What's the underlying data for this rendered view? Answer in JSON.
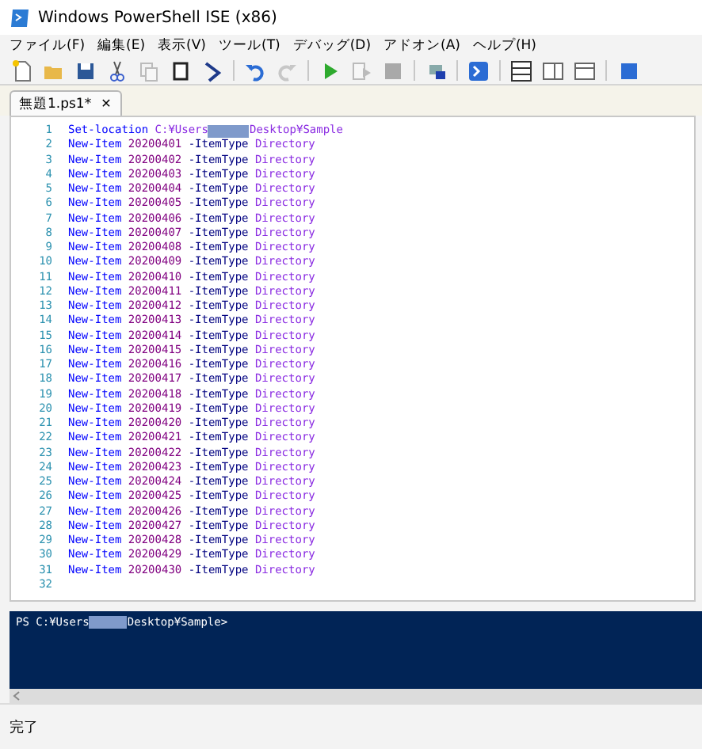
{
  "window": {
    "title": "Windows PowerShell ISE (x86)"
  },
  "menu": [
    "ファイル(F)",
    "編集(E)",
    "表示(V)",
    "ツール(T)",
    "デバッグ(D)",
    "アドオン(A)",
    "ヘルプ(H)"
  ],
  "toolbar": [
    {
      "kind": "new",
      "disabled": false
    },
    {
      "kind": "open",
      "disabled": false
    },
    {
      "kind": "save",
      "disabled": false
    },
    {
      "kind": "cut",
      "disabled": false
    },
    {
      "kind": "copy",
      "disabled": true
    },
    {
      "kind": "paste",
      "disabled": false
    },
    {
      "kind": "clear",
      "disabled": false
    },
    {
      "kind": "sep"
    },
    {
      "kind": "undo",
      "disabled": false
    },
    {
      "kind": "redo",
      "disabled": true
    },
    {
      "kind": "sep"
    },
    {
      "kind": "run",
      "disabled": false
    },
    {
      "kind": "runsel",
      "disabled": true
    },
    {
      "kind": "stop",
      "disabled": true
    },
    {
      "kind": "sep"
    },
    {
      "kind": "remote",
      "disabled": false
    },
    {
      "kind": "sep"
    },
    {
      "kind": "console",
      "disabled": false
    },
    {
      "kind": "sep"
    },
    {
      "kind": "layout-top",
      "disabled": false
    },
    {
      "kind": "layout-right",
      "disabled": false
    },
    {
      "kind": "layout-max",
      "disabled": false
    },
    {
      "kind": "sep"
    },
    {
      "kind": "addon",
      "disabled": false
    }
  ],
  "tabs": [
    {
      "label": "無題1.ps1*",
      "close": "✕",
      "selected": true
    }
  ],
  "editor": {
    "lines": [
      {
        "number": "1",
        "tokens": [
          {
            "kind": "cmdlet",
            "text": "Set-location"
          },
          {
            "kind": "argument",
            "text": "C:¥Users"
          },
          {
            "kind": "redacted"
          },
          {
            "kind": "argument",
            "text": "Desktop¥Sample"
          }
        ]
      },
      {
        "number": "2",
        "tokens": [
          {
            "kind": "cmdlet",
            "text": "New-Item"
          },
          {
            "kind": "number",
            "text": "20200401"
          },
          {
            "kind": "parameter",
            "text": "-ItemType"
          },
          {
            "kind": "argument",
            "text": "Directory"
          }
        ]
      },
      {
        "number": "3",
        "tokens": [
          {
            "kind": "cmdlet",
            "text": "New-Item"
          },
          {
            "kind": "number",
            "text": "20200402"
          },
          {
            "kind": "parameter",
            "text": "-ItemType"
          },
          {
            "kind": "argument",
            "text": "Directory"
          }
        ]
      },
      {
        "number": "4",
        "tokens": [
          {
            "kind": "cmdlet",
            "text": "New-Item"
          },
          {
            "kind": "number",
            "text": "20200403"
          },
          {
            "kind": "parameter",
            "text": "-ItemType"
          },
          {
            "kind": "argument",
            "text": "Directory"
          }
        ]
      },
      {
        "number": "5",
        "tokens": [
          {
            "kind": "cmdlet",
            "text": "New-Item"
          },
          {
            "kind": "number",
            "text": "20200404"
          },
          {
            "kind": "parameter",
            "text": "-ItemType"
          },
          {
            "kind": "argument",
            "text": "Directory"
          }
        ]
      },
      {
        "number": "6",
        "tokens": [
          {
            "kind": "cmdlet",
            "text": "New-Item"
          },
          {
            "kind": "number",
            "text": "20200405"
          },
          {
            "kind": "parameter",
            "text": "-ItemType"
          },
          {
            "kind": "argument",
            "text": "Directory"
          }
        ]
      },
      {
        "number": "7",
        "tokens": [
          {
            "kind": "cmdlet",
            "text": "New-Item"
          },
          {
            "kind": "number",
            "text": "20200406"
          },
          {
            "kind": "parameter",
            "text": "-ItemType"
          },
          {
            "kind": "argument",
            "text": "Directory"
          }
        ]
      },
      {
        "number": "8",
        "tokens": [
          {
            "kind": "cmdlet",
            "text": "New-Item"
          },
          {
            "kind": "number",
            "text": "20200407"
          },
          {
            "kind": "parameter",
            "text": "-ItemType"
          },
          {
            "kind": "argument",
            "text": "Directory"
          }
        ]
      },
      {
        "number": "9",
        "tokens": [
          {
            "kind": "cmdlet",
            "text": "New-Item"
          },
          {
            "kind": "number",
            "text": "20200408"
          },
          {
            "kind": "parameter",
            "text": "-ItemType"
          },
          {
            "kind": "argument",
            "text": "Directory"
          }
        ]
      },
      {
        "number": "10",
        "tokens": [
          {
            "kind": "cmdlet",
            "text": "New-Item"
          },
          {
            "kind": "number",
            "text": "20200409"
          },
          {
            "kind": "parameter",
            "text": "-ItemType"
          },
          {
            "kind": "argument",
            "text": "Directory"
          }
        ]
      },
      {
        "number": "11",
        "tokens": [
          {
            "kind": "cmdlet",
            "text": "New-Item"
          },
          {
            "kind": "number",
            "text": "20200410"
          },
          {
            "kind": "parameter",
            "text": "-ItemType"
          },
          {
            "kind": "argument",
            "text": "Directory"
          }
        ]
      },
      {
        "number": "12",
        "tokens": [
          {
            "kind": "cmdlet",
            "text": "New-Item"
          },
          {
            "kind": "number",
            "text": "20200411"
          },
          {
            "kind": "parameter",
            "text": "-ItemType"
          },
          {
            "kind": "argument",
            "text": "Directory"
          }
        ]
      },
      {
        "number": "13",
        "tokens": [
          {
            "kind": "cmdlet",
            "text": "New-Item"
          },
          {
            "kind": "number",
            "text": "20200412"
          },
          {
            "kind": "parameter",
            "text": "-ItemType"
          },
          {
            "kind": "argument",
            "text": "Directory"
          }
        ]
      },
      {
        "number": "14",
        "tokens": [
          {
            "kind": "cmdlet",
            "text": "New-Item"
          },
          {
            "kind": "number",
            "text": "20200413"
          },
          {
            "kind": "parameter",
            "text": "-ItemType"
          },
          {
            "kind": "argument",
            "text": "Directory"
          }
        ]
      },
      {
        "number": "15",
        "tokens": [
          {
            "kind": "cmdlet",
            "text": "New-Item"
          },
          {
            "kind": "number",
            "text": "20200414"
          },
          {
            "kind": "parameter",
            "text": "-ItemType"
          },
          {
            "kind": "argument",
            "text": "Directory"
          }
        ]
      },
      {
        "number": "16",
        "tokens": [
          {
            "kind": "cmdlet",
            "text": "New-Item"
          },
          {
            "kind": "number",
            "text": "20200415"
          },
          {
            "kind": "parameter",
            "text": "-ItemType"
          },
          {
            "kind": "argument",
            "text": "Directory"
          }
        ]
      },
      {
        "number": "17",
        "tokens": [
          {
            "kind": "cmdlet",
            "text": "New-Item"
          },
          {
            "kind": "number",
            "text": "20200416"
          },
          {
            "kind": "parameter",
            "text": "-ItemType"
          },
          {
            "kind": "argument",
            "text": "Directory"
          }
        ]
      },
      {
        "number": "18",
        "tokens": [
          {
            "kind": "cmdlet",
            "text": "New-Item"
          },
          {
            "kind": "number",
            "text": "20200417"
          },
          {
            "kind": "parameter",
            "text": "-ItemType"
          },
          {
            "kind": "argument",
            "text": "Directory"
          }
        ]
      },
      {
        "number": "19",
        "tokens": [
          {
            "kind": "cmdlet",
            "text": "New-Item"
          },
          {
            "kind": "number",
            "text": "20200418"
          },
          {
            "kind": "parameter",
            "text": "-ItemType"
          },
          {
            "kind": "argument",
            "text": "Directory"
          }
        ]
      },
      {
        "number": "20",
        "tokens": [
          {
            "kind": "cmdlet",
            "text": "New-Item"
          },
          {
            "kind": "number",
            "text": "20200419"
          },
          {
            "kind": "parameter",
            "text": "-ItemType"
          },
          {
            "kind": "argument",
            "text": "Directory"
          }
        ]
      },
      {
        "number": "21",
        "tokens": [
          {
            "kind": "cmdlet",
            "text": "New-Item"
          },
          {
            "kind": "number",
            "text": "20200420"
          },
          {
            "kind": "parameter",
            "text": "-ItemType"
          },
          {
            "kind": "argument",
            "text": "Directory"
          }
        ]
      },
      {
        "number": "22",
        "tokens": [
          {
            "kind": "cmdlet",
            "text": "New-Item"
          },
          {
            "kind": "number",
            "text": "20200421"
          },
          {
            "kind": "parameter",
            "text": "-ItemType"
          },
          {
            "kind": "argument",
            "text": "Directory"
          }
        ]
      },
      {
        "number": "23",
        "tokens": [
          {
            "kind": "cmdlet",
            "text": "New-Item"
          },
          {
            "kind": "number",
            "text": "20200422"
          },
          {
            "kind": "parameter",
            "text": "-ItemType"
          },
          {
            "kind": "argument",
            "text": "Directory"
          }
        ]
      },
      {
        "number": "24",
        "tokens": [
          {
            "kind": "cmdlet",
            "text": "New-Item"
          },
          {
            "kind": "number",
            "text": "20200423"
          },
          {
            "kind": "parameter",
            "text": "-ItemType"
          },
          {
            "kind": "argument",
            "text": "Directory"
          }
        ]
      },
      {
        "number": "25",
        "tokens": [
          {
            "kind": "cmdlet",
            "text": "New-Item"
          },
          {
            "kind": "number",
            "text": "20200424"
          },
          {
            "kind": "parameter",
            "text": "-ItemType"
          },
          {
            "kind": "argument",
            "text": "Directory"
          }
        ]
      },
      {
        "number": "26",
        "tokens": [
          {
            "kind": "cmdlet",
            "text": "New-Item"
          },
          {
            "kind": "number",
            "text": "20200425"
          },
          {
            "kind": "parameter",
            "text": "-ItemType"
          },
          {
            "kind": "argument",
            "text": "Directory"
          }
        ]
      },
      {
        "number": "27",
        "tokens": [
          {
            "kind": "cmdlet",
            "text": "New-Item"
          },
          {
            "kind": "number",
            "text": "20200426"
          },
          {
            "kind": "parameter",
            "text": "-ItemType"
          },
          {
            "kind": "argument",
            "text": "Directory"
          }
        ]
      },
      {
        "number": "28",
        "tokens": [
          {
            "kind": "cmdlet",
            "text": "New-Item"
          },
          {
            "kind": "number",
            "text": "20200427"
          },
          {
            "kind": "parameter",
            "text": "-ItemType"
          },
          {
            "kind": "argument",
            "text": "Directory"
          }
        ]
      },
      {
        "number": "29",
        "tokens": [
          {
            "kind": "cmdlet",
            "text": "New-Item"
          },
          {
            "kind": "number",
            "text": "20200428"
          },
          {
            "kind": "parameter",
            "text": "-ItemType"
          },
          {
            "kind": "argument",
            "text": "Directory"
          }
        ]
      },
      {
        "number": "30",
        "tokens": [
          {
            "kind": "cmdlet",
            "text": "New-Item"
          },
          {
            "kind": "number",
            "text": "20200429"
          },
          {
            "kind": "parameter",
            "text": "-ItemType"
          },
          {
            "kind": "argument",
            "text": "Directory"
          }
        ]
      },
      {
        "number": "31",
        "tokens": [
          {
            "kind": "cmdlet",
            "text": "New-Item"
          },
          {
            "kind": "number",
            "text": "20200430"
          },
          {
            "kind": "parameter",
            "text": "-ItemType"
          },
          {
            "kind": "argument",
            "text": "Directory"
          }
        ]
      },
      {
        "number": "32"
      }
    ]
  },
  "console": {
    "prompt": [
      {
        "kind": "text",
        "text": "PS C:¥Users"
      },
      {
        "kind": "redacted"
      },
      {
        "kind": "text",
        "text": "Desktop¥Sample>"
      }
    ]
  },
  "status_bar": {
    "text": "完了"
  }
}
